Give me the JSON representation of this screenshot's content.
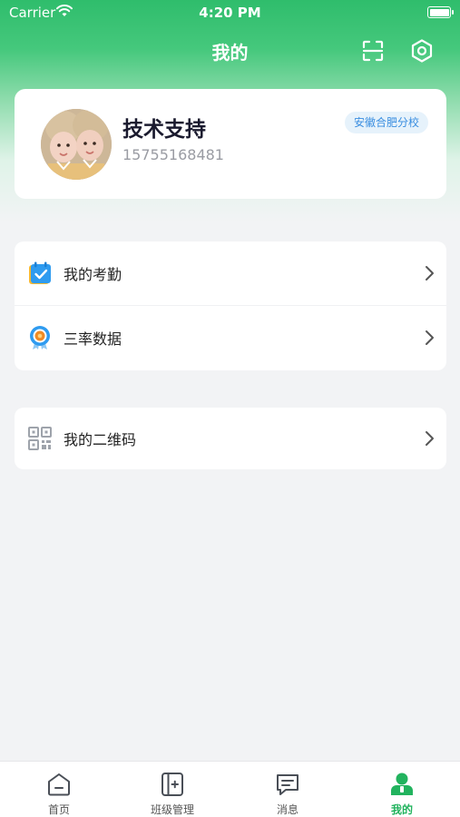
{
  "status_bar": {
    "carrier": "Carrier",
    "time": "4:20 PM"
  },
  "nav": {
    "title": "我的"
  },
  "profile": {
    "name": "技术支持",
    "phone": "15755168481",
    "branch": "安徽合肥分校"
  },
  "menu": {
    "group1": [
      {
        "label": "我的考勤",
        "icon": "calendar-check-icon"
      },
      {
        "label": "三率数据",
        "icon": "medal-icon"
      }
    ],
    "group2": [
      {
        "label": "我的二维码",
        "icon": "qr-code-icon"
      }
    ]
  },
  "tabs": [
    {
      "label": "首页",
      "icon": "home-icon"
    },
    {
      "label": "班级管理",
      "icon": "class-icon"
    },
    {
      "label": "消息",
      "icon": "message-icon"
    },
    {
      "label": "我的",
      "icon": "user-icon",
      "active": true
    }
  ],
  "colors": {
    "accent": "#22b35e",
    "badge_text": "#3a8ee0"
  }
}
